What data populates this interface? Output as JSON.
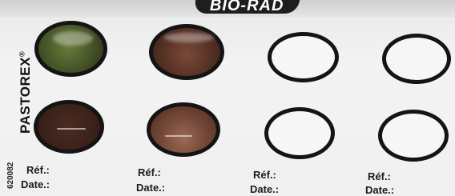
{
  "logo_text": "BIO-RAD",
  "brand": {
    "name": "PASTOREX",
    "mark": "®"
  },
  "lot_code": "620082",
  "wells": [
    {
      "id": "1",
      "state": "green agglutination"
    },
    {
      "id": "2",
      "state": "brown fill"
    },
    {
      "id": "3",
      "state": "empty"
    },
    {
      "id": "4",
      "state": "empty"
    },
    {
      "id": "5",
      "state": "brown fill"
    },
    {
      "id": "6",
      "state": "brown fill"
    },
    {
      "id": "7",
      "state": "empty"
    },
    {
      "id": "8",
      "state": "empty"
    }
  ],
  "fields": [
    {
      "ref": "Réf.:",
      "date": "Date.:"
    },
    {
      "ref": "Réf.:",
      "date": "Date.:"
    },
    {
      "ref": "Réf.:",
      "date": "Date.:"
    },
    {
      "ref": "Réf.:",
      "date": "Date.:"
    }
  ]
}
